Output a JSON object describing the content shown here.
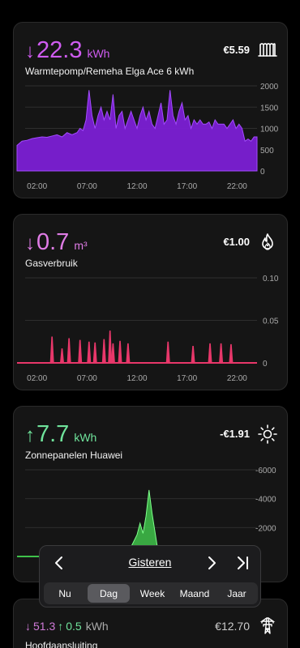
{
  "cards": [
    {
      "arrow": "↓",
      "value": "22.3",
      "unit": "kWh",
      "name": "Warmtepomp/Remeha Elga Ace 6 kWh",
      "cost": "€5.59",
      "icon": "radiator-icon",
      "color": "#cf5cf0",
      "chart_color": "#7b1fd4",
      "y_ticks": [
        "2000",
        "1500",
        "1000",
        "500",
        "0"
      ],
      "x_ticks": [
        "02:00",
        "07:00",
        "12:00",
        "17:00",
        "22:00"
      ]
    },
    {
      "arrow": "↓",
      "value": "0.7",
      "unit": "m³",
      "name": "Gasverbruik",
      "cost": "€1.00",
      "icon": "flame-icon",
      "color": "#e07ce6",
      "chart_color": "#e8376a",
      "y_ticks": [
        "0.10",
        "0.05",
        "0"
      ],
      "x_ticks": [
        "02:00",
        "07:00",
        "12:00",
        "17:00",
        "22:00"
      ]
    },
    {
      "arrow": "↑",
      "value": "7.7",
      "unit": "kWh",
      "name": "Zonnepanelen Huawei",
      "cost": "-€1.91",
      "icon": "sun-icon",
      "color": "#6fe39b",
      "chart_color": "#3fc24a",
      "y_ticks": [
        "-6000",
        "-4000",
        "-2000"
      ],
      "x_ticks": []
    },
    {
      "import_arrow": "↓",
      "import_value": "51.3",
      "export_arrow": "↑",
      "export_value": "0.5",
      "unit": "kWh",
      "name": "Hoofdaansluiting",
      "cost": "€12.70",
      "icon": "power-pylon-icon"
    }
  ],
  "chart_data": [
    {
      "type": "area",
      "title": "",
      "x_unit": "hour",
      "xlim": [
        0,
        24
      ],
      "ylim": [
        0,
        2000
      ],
      "x": [
        0,
        0.5,
        1,
        1.5,
        2,
        2.5,
        3,
        3.5,
        4,
        4.5,
        5,
        5.5,
        6,
        6.3,
        6.6,
        6.9,
        7.2,
        7.5,
        7.8,
        8.1,
        8.4,
        8.7,
        9,
        9.3,
        9.6,
        9.9,
        10.2,
        10.5,
        10.8,
        11.1,
        11.4,
        11.7,
        12,
        12.3,
        12.6,
        12.9,
        13.2,
        13.5,
        13.8,
        14.1,
        14.4,
        14.7,
        15,
        15.3,
        15.6,
        15.9,
        16.2,
        16.5,
        16.8,
        17.1,
        17.4,
        17.7,
        18,
        18.3,
        18.6,
        18.9,
        19.2,
        19.5,
        19.8,
        20.1,
        20.4,
        20.7,
        21,
        21.3,
        21.6,
        21.9,
        22.2,
        22.5,
        22.8,
        23.1,
        23.4,
        23.7,
        24
      ],
      "series": [
        {
          "values": [
            600,
            700,
            720,
            760,
            780,
            800,
            790,
            820,
            850,
            800,
            900,
            850,
            900,
            1000,
            950,
            1200,
            1900,
            1300,
            1000,
            1300,
            1500,
            1200,
            1400,
            1200,
            1800,
            1000,
            1300,
            1400,
            1000,
            1200,
            1400,
            1200,
            1000,
            1300,
            1500,
            1200,
            1400,
            1100,
            1000,
            1300,
            1600,
            1100,
            1200,
            1900,
            1300,
            1100,
            1400,
            1600,
            1200,
            1300,
            1000,
            1200,
            1100,
            1200,
            1100,
            1100,
            1150,
            1000,
            1200,
            1100,
            1100,
            1100,
            1000,
            1100,
            1200,
            1000,
            1100,
            1000,
            700,
            750,
            700,
            800,
            800
          ]
        }
      ]
    },
    {
      "type": "bar",
      "title": "",
      "x_unit": "hour",
      "xlim": [
        0,
        24
      ],
      "ylim": [
        0,
        0.1
      ],
      "x": [
        3.5,
        4.5,
        5.2,
        6.3,
        7.2,
        7.8,
        8.7,
        9.3,
        9.6,
        10.3,
        11.1,
        15.1,
        17.6,
        19.3,
        20.4,
        21.4
      ],
      "series": [
        {
          "values": [
            0.031,
            0.017,
            0.029,
            0.027,
            0.025,
            0.024,
            0.028,
            0.038,
            0.023,
            0.026,
            0.023,
            0.025,
            0.02,
            0.023,
            0.023,
            0.022
          ]
        }
      ]
    },
    {
      "type": "area",
      "title": "",
      "x_unit": "hour",
      "xlim": [
        0,
        24
      ],
      "ylim": [
        -6000,
        0
      ],
      "x": [
        0,
        6,
        8,
        9,
        10,
        10.5,
        11,
        11.5,
        12,
        12.3,
        12.6,
        12.9,
        13.2,
        13.5,
        14,
        14.5,
        15,
        16,
        24
      ],
      "series": [
        {
          "values": [
            0,
            0,
            -10,
            -50,
            -100,
            -200,
            -400,
            -800,
            -1500,
            -2300,
            -1600,
            -2800,
            -4600,
            -3000,
            -800,
            -200,
            -50,
            0,
            0
          ]
        }
      ]
    }
  ],
  "popup": {
    "period_label": "Gisteren",
    "segments": [
      "Nu",
      "Dag",
      "Week",
      "Maand",
      "Jaar"
    ],
    "active_segment": "Dag"
  }
}
